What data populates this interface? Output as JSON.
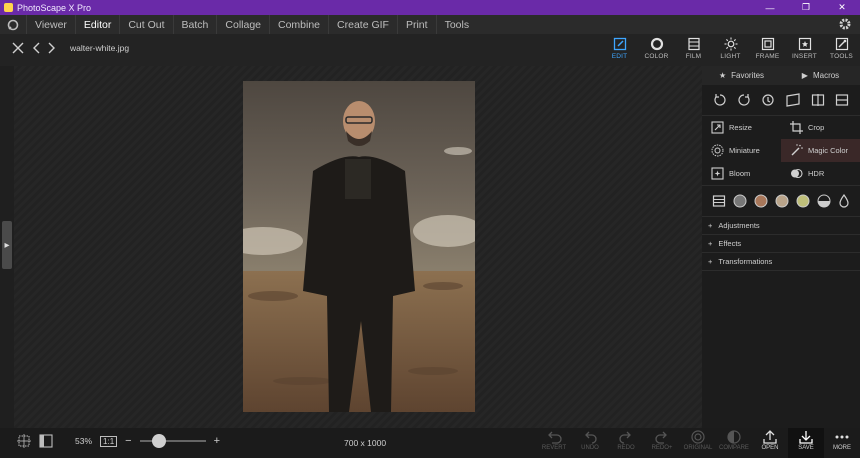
{
  "window": {
    "title": "PhotoScape X Pro"
  },
  "menu": {
    "items": [
      "Viewer",
      "Editor",
      "Cut Out",
      "Batch",
      "Collage",
      "Combine",
      "Create GIF",
      "Print",
      "Tools"
    ]
  },
  "file": {
    "name": "walter-white.jpg"
  },
  "tools": [
    {
      "label": "EDIT",
      "icon": "edit-icon"
    },
    {
      "label": "COLOR",
      "icon": "color-icon"
    },
    {
      "label": "FILM",
      "icon": "film-icon"
    },
    {
      "label": "LIGHT",
      "icon": "light-icon"
    },
    {
      "label": "FRAME",
      "icon": "frame-icon"
    },
    {
      "label": "INSERT",
      "icon": "insert-icon"
    },
    {
      "label": "TOOLS",
      "icon": "tools-icon"
    }
  ],
  "panel": {
    "tabs": {
      "favorites": "Favorites",
      "macros": "Macros"
    },
    "grid": {
      "resize": "Resize",
      "crop": "Crop",
      "miniature": "Miniature",
      "magic_color": "Magic Color",
      "bloom": "Bloom",
      "hdr": "HDR"
    },
    "sections": {
      "adjustments": "Adjustments",
      "effects": "Effects",
      "transformations": "Transformations"
    }
  },
  "bottom": {
    "zoom": "53%",
    "actual_size": "1:1",
    "minus": "−",
    "plus": "+",
    "dimensions": "700 x 1000",
    "actions": {
      "revert": "REVERT",
      "undo": "UNDO",
      "redo": "REDO",
      "redo_all": "REDO+",
      "original": "ORIGINAL",
      "compare": "COMPARE",
      "open": "OPEN",
      "save": "SAVE",
      "more": "MORE"
    }
  },
  "colors": {
    "title_bar": "#6a2aa8",
    "accent": "#3ea6ff",
    "highlight": "#3a2828"
  }
}
